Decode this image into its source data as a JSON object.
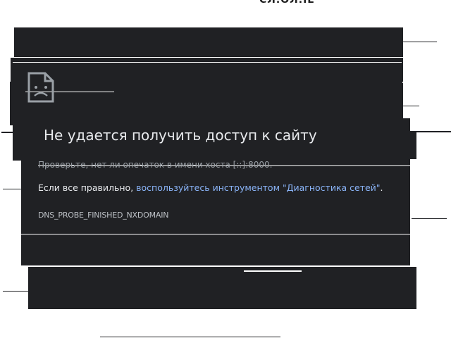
{
  "top_fragment": "СЛ.ОЛ.ІЕ",
  "error": {
    "title": "Не удается получить доступ к сайту",
    "check_text": "Проверьте, нет ли опечаток в имени хоста [::]:8000.",
    "correct_prefix": "Если все правильно, ",
    "diagnostic_link": "воспользуйтесь инструментом \"Диагностика сетей\"",
    "correct_suffix": ".",
    "code": "DNS_PROBE_FINISHED_NXDOMAIN"
  },
  "colors": {
    "page_background": "#202124",
    "title_text": "#e8eaed",
    "link": "#8ab4f8",
    "muted_text": "#9aa0a6"
  },
  "icons": {
    "error_icon": "sad-document-icon"
  }
}
